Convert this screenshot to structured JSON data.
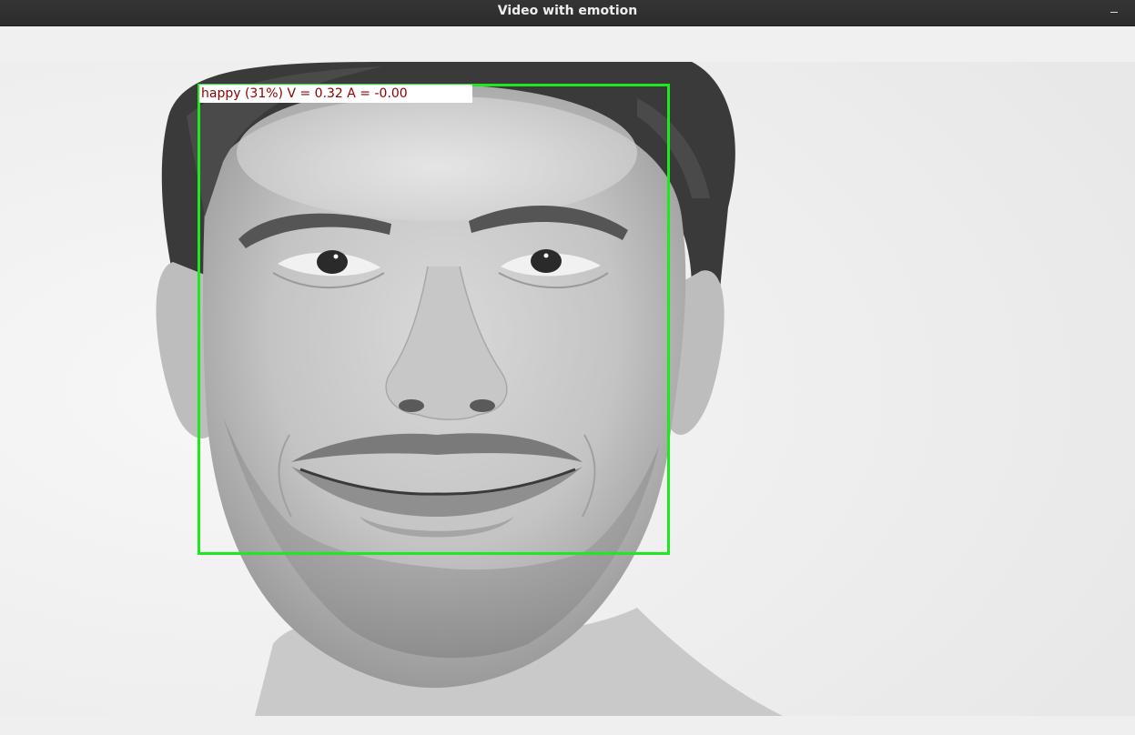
{
  "window": {
    "title": "Video with emotion",
    "minimize_symbol": "–"
  },
  "video": {
    "detection": {
      "emotion": "happy",
      "confidence_percent": 31,
      "valence": 0.32,
      "arousal": -0.0,
      "label": "happy (31%) V = 0.32 A = -0.00",
      "box_color": "#1ee81e",
      "label_text_color": "#8b0000",
      "label_bg_color": "#ffffff"
    }
  },
  "icons": {
    "minimize": "minimize-icon"
  }
}
